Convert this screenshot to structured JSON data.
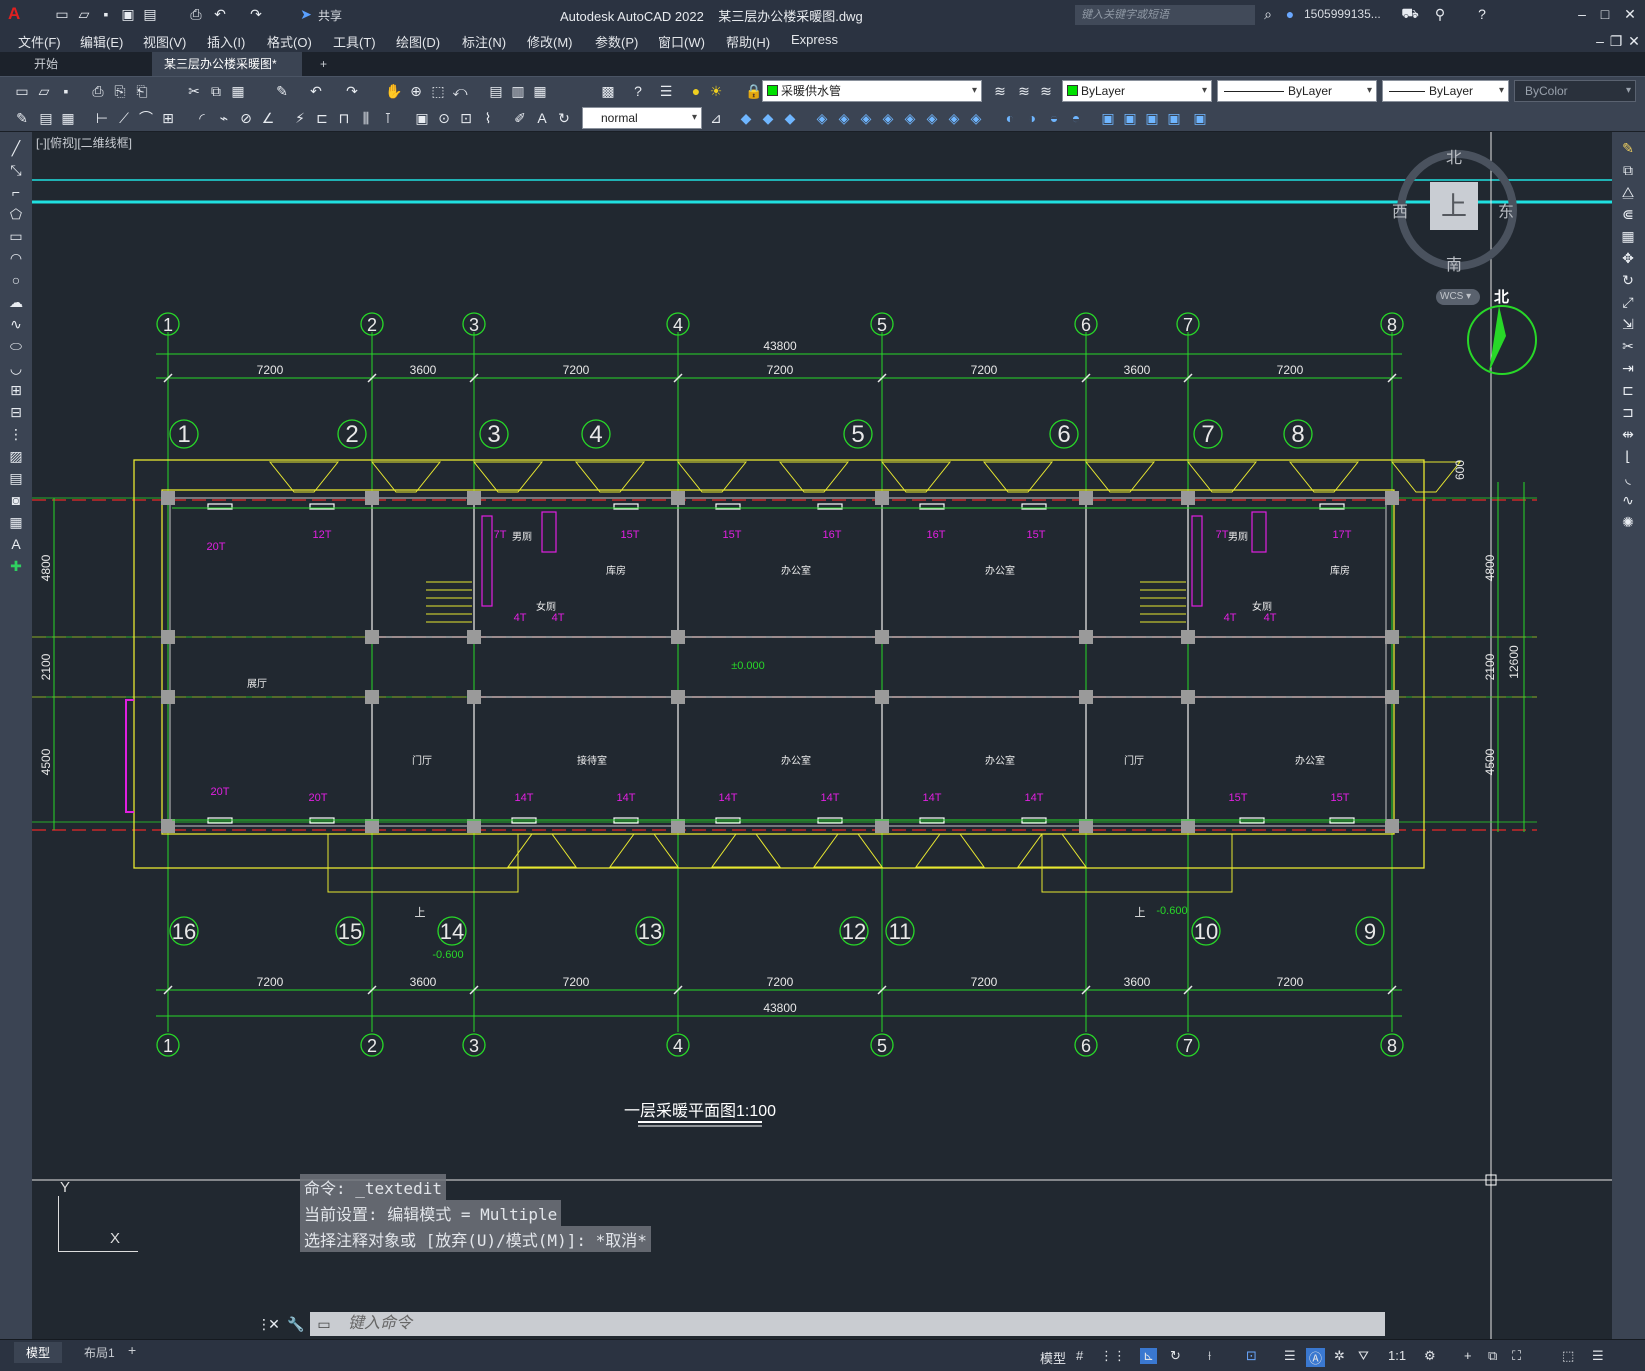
{
  "app": {
    "title": "Autodesk AutoCAD 2022",
    "filename": "某三层办公楼采暖图.dwg",
    "share": "共享",
    "search_placeholder": "键入关键字或短语",
    "user": "1505999135...",
    "logo": "A"
  },
  "menu": [
    "文件(F)",
    "编辑(E)",
    "视图(V)",
    "插入(I)",
    "格式(O)",
    "工具(T)",
    "绘图(D)",
    "标注(N)",
    "修改(M)",
    "参数(P)",
    "窗口(W)",
    "帮助(H)",
    "Express"
  ],
  "tabs": [
    "开始",
    "某三层办公楼采暖图*"
  ],
  "toolbar": {
    "layer": "采暖供水管",
    "color": "ByLayer",
    "linetype": "ByLayer",
    "lineweight": "ByLayer",
    "plotstyle": "ByColor",
    "textstyle": "normal"
  },
  "viewport": {
    "label": "[-][俯视][二维线框]",
    "viewcube_top": "上",
    "north": "北",
    "south": "南",
    "east": "东",
    "west": "西",
    "wcs": "WCS",
    "compass_n": "北"
  },
  "drawing": {
    "axis_top": [
      "1",
      "2",
      "3",
      "4",
      "5",
      "6",
      "7",
      "8"
    ],
    "axis_inner_top": [
      "1",
      "2",
      "3",
      "4",
      "5",
      "6",
      "7",
      "8"
    ],
    "axis_bottom": [
      "16",
      "15",
      "14",
      "13",
      "12",
      "11",
      "10",
      "9"
    ],
    "axis_bottom2": [
      "1",
      "2",
      "3",
      "4",
      "5",
      "6",
      "7",
      "8"
    ],
    "dims": [
      "7200",
      "3600",
      "7200",
      "7200",
      "7200",
      "3600",
      "7200"
    ],
    "total": "43800",
    "side_dims": [
      "4800",
      "2100",
      "4500"
    ],
    "right_dims": [
      "600",
      "4800",
      "2100",
      "4500",
      "12600"
    ],
    "rooms": [
      "展厅",
      "库房",
      "办公室",
      "办公室",
      "库房",
      "门厅",
      "接待室",
      "办公室",
      "办公室",
      "门厅",
      "办公室",
      "男厕",
      "女厕",
      "男厕",
      "女厕"
    ],
    "radiators_top": [
      "20T",
      "12T",
      "7T",
      "15T",
      "15T",
      "16T",
      "16T",
      "15T",
      "7T",
      "17T"
    ],
    "radiators_mid": [
      "4T",
      "4T",
      "4T",
      "4T"
    ],
    "radiators_bottom": [
      "20T",
      "20T",
      "14T",
      "14T",
      "14T",
      "14T",
      "14T",
      "14T",
      "15T",
      "15T"
    ],
    "elev_0": "±0.000",
    "elev_neg1": "-0.600",
    "elev_neg2": "-0.600",
    "stair_up": "上",
    "title": "一层采暖平面图1:100"
  },
  "command": {
    "line1": "命令:  _textedit",
    "line2": "当前设置: 编辑模式 = Multiple",
    "line3": "选择注释对象或 [放弃(U)/模式(M)]: *取消*",
    "input_placeholder": "键入命令"
  },
  "ucs": {
    "x": "X",
    "y": "Y"
  },
  "layout_tabs": [
    "模型",
    "布局1"
  ],
  "status": {
    "model": "模型",
    "scale": "1:1"
  },
  "colors": {
    "wall": "#e8e830",
    "grid": "#28d828",
    "axis_red": "#e82828",
    "magenta": "#e020e0",
    "cyan": "#20e0e0",
    "bg": "#212830"
  }
}
